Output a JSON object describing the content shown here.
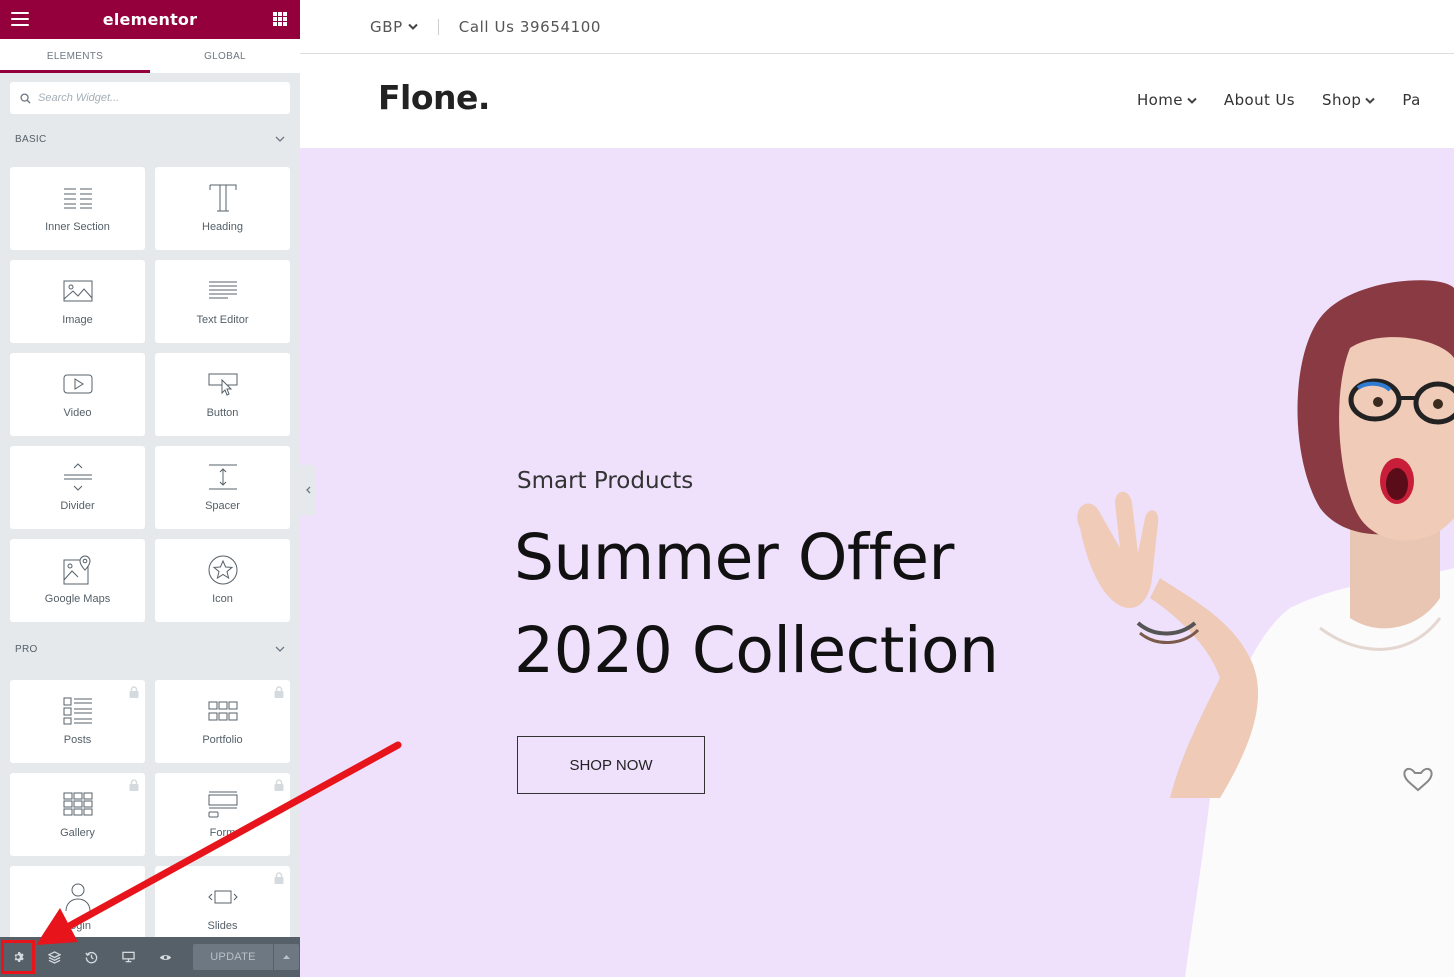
{
  "panel": {
    "brand": "elementor",
    "tabs": [
      {
        "label": "ELEMENTS",
        "active": true
      },
      {
        "label": "GLOBAL",
        "active": false
      }
    ],
    "search": {
      "placeholder": "Search Widget..."
    },
    "categories": {
      "basic": "BASIC",
      "pro": "PRO"
    },
    "basic_widgets": [
      {
        "label": "Inner Section",
        "icon": "inner-section-icon"
      },
      {
        "label": "Heading",
        "icon": "heading-icon"
      },
      {
        "label": "Image",
        "icon": "image-icon"
      },
      {
        "label": "Text Editor",
        "icon": "text-editor-icon"
      },
      {
        "label": "Video",
        "icon": "video-icon"
      },
      {
        "label": "Button",
        "icon": "button-icon"
      },
      {
        "label": "Divider",
        "icon": "divider-icon"
      },
      {
        "label": "Spacer",
        "icon": "spacer-icon"
      },
      {
        "label": "Google Maps",
        "icon": "google-maps-icon"
      },
      {
        "label": "Icon",
        "icon": "star-icon"
      }
    ],
    "pro_widgets": [
      {
        "label": "Posts",
        "icon": "posts-icon",
        "locked": true
      },
      {
        "label": "Portfolio",
        "icon": "portfolio-icon",
        "locked": true
      },
      {
        "label": "Gallery",
        "icon": "gallery-icon",
        "locked": true
      },
      {
        "label": "Form",
        "icon": "form-icon",
        "locked": true
      },
      {
        "label": "Login",
        "icon": "login-icon",
        "locked": false
      },
      {
        "label": "Slides",
        "icon": "slides-icon",
        "locked": true
      }
    ],
    "footer": {
      "update_label": "UPDATE",
      "buttons": [
        "settings-icon",
        "layers-icon",
        "history-icon",
        "responsive-icon",
        "preview-eye-icon"
      ]
    },
    "colors": {
      "brand": "#93003c",
      "panel_bg": "#e6e9ec",
      "footer_bg": "#556068",
      "highlight": "#e8141b"
    }
  },
  "site": {
    "topbar": {
      "currency": "GBP",
      "phone": "Call Us 39654100"
    },
    "logo": "Flone.",
    "nav": [
      {
        "label": "Home",
        "has_dropdown": true
      },
      {
        "label": "About Us",
        "has_dropdown": false
      },
      {
        "label": "Shop",
        "has_dropdown": true
      },
      {
        "label": "Pa",
        "has_dropdown": false
      }
    ],
    "hero": {
      "subtitle": "Smart Products",
      "title_line1": "Summer Offer",
      "title_line2": "2020 Collection",
      "cta": "SHOP NOW",
      "bg_color": "#efe0fc"
    }
  }
}
